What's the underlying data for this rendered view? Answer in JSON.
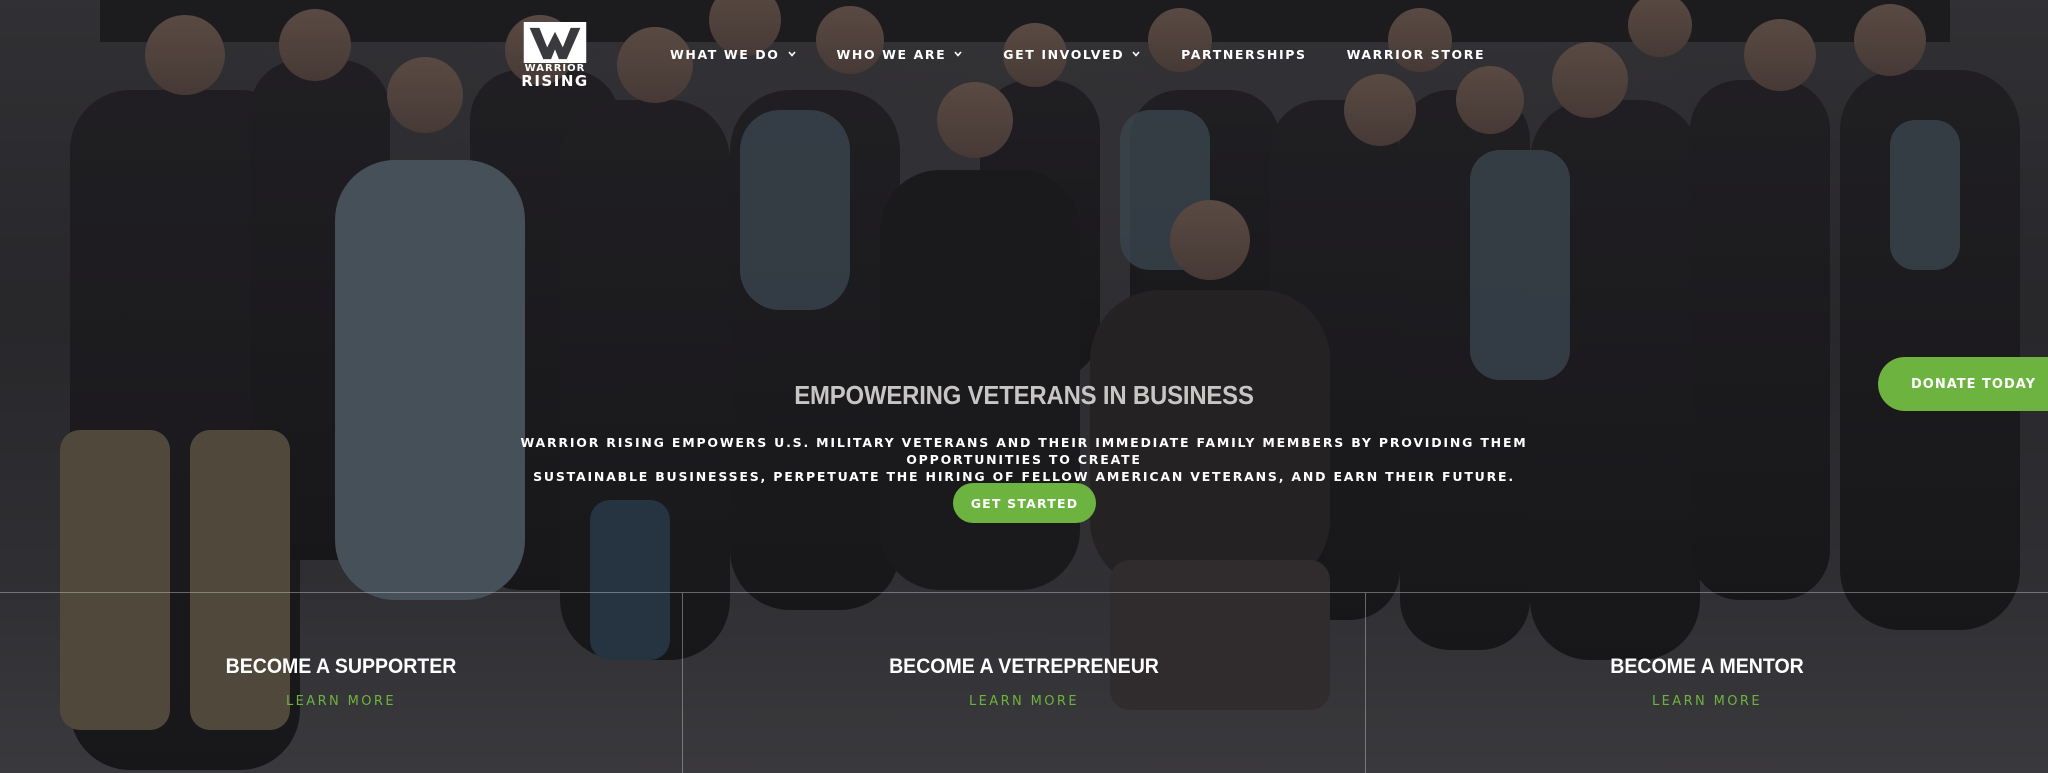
{
  "brand": {
    "logo_line1": "WARRIOR",
    "logo_line2": "RISING",
    "logo_icon": "warrior-rising-w-logo"
  },
  "nav": {
    "items": [
      {
        "label": "WHAT WE DO",
        "dropdown": true
      },
      {
        "label": "WHO WE ARE",
        "dropdown": true
      },
      {
        "label": "GET INVOLVED",
        "dropdown": true
      },
      {
        "label": "PARTNERSHIPS",
        "dropdown": false
      },
      {
        "label": "WARRIOR STORE",
        "dropdown": false
      }
    ]
  },
  "donate": {
    "label": "DONATE TODAY"
  },
  "hero": {
    "headline": "EMPOWERING VETERANS IN BUSINESS",
    "subtext_line1": "WARRIOR RISING EMPOWERS U.S. MILITARY VETERANS AND THEIR IMMEDIATE FAMILY MEMBERS BY PROVIDING THEM OPPORTUNITIES TO CREATE",
    "subtext_line2": "SUSTAINABLE BUSINESSES, PERPETUATE THE HIRING OF FELLOW AMERICAN VETERANS, AND EARN THEIR FUTURE.",
    "cta_label": "GET STARTED"
  },
  "panels": [
    {
      "title": "BECOME A SUPPORTER",
      "link": "LEARN MORE"
    },
    {
      "title": "BECOME A VETREPRENEUR",
      "link": "LEARN MORE"
    },
    {
      "title": "BECOME A MENTOR",
      "link": "LEARN MORE"
    }
  ],
  "colors": {
    "accent_green": "#6db33f",
    "text_white": "#ffffff"
  }
}
